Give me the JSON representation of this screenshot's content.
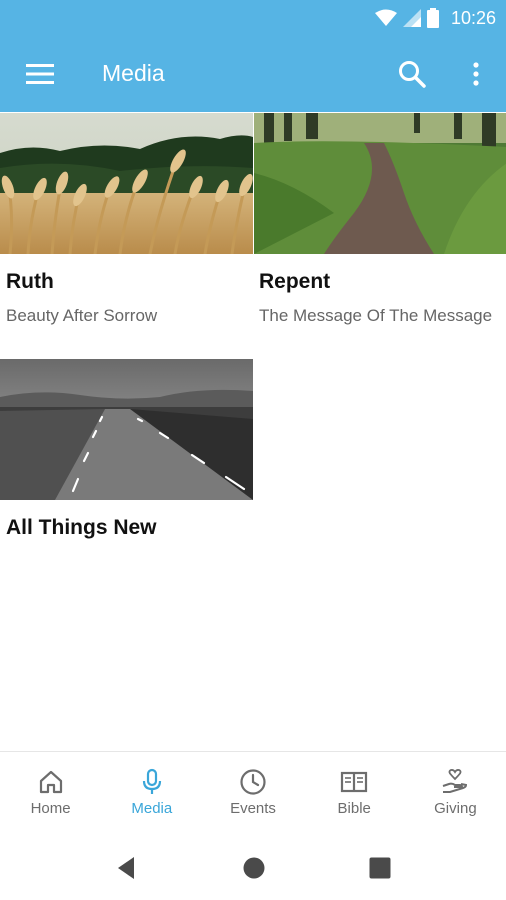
{
  "status_bar": {
    "time": "10:26"
  },
  "app_bar": {
    "title": "Media"
  },
  "media_items": [
    {
      "title": "Ruth",
      "subtitle": "Beauty After Sorrow",
      "image": "wheat-field"
    },
    {
      "title": "Repent",
      "subtitle": "The Message Of The Message",
      "image": "forest-path"
    },
    {
      "title": "All Things New",
      "subtitle": "",
      "image": "road-bw"
    }
  ],
  "bottom_nav": {
    "items": [
      {
        "label": "Home",
        "icon": "home-icon"
      },
      {
        "label": "Media",
        "icon": "microphone-icon",
        "active": true
      },
      {
        "label": "Events",
        "icon": "clock-icon"
      },
      {
        "label": "Bible",
        "icon": "book-icon"
      },
      {
        "label": "Giving",
        "icon": "giving-hand-icon"
      }
    ]
  },
  "colors": {
    "primary": "#56b4e4",
    "active": "#3aa6d9",
    "inactive": "#6d6d6d"
  }
}
